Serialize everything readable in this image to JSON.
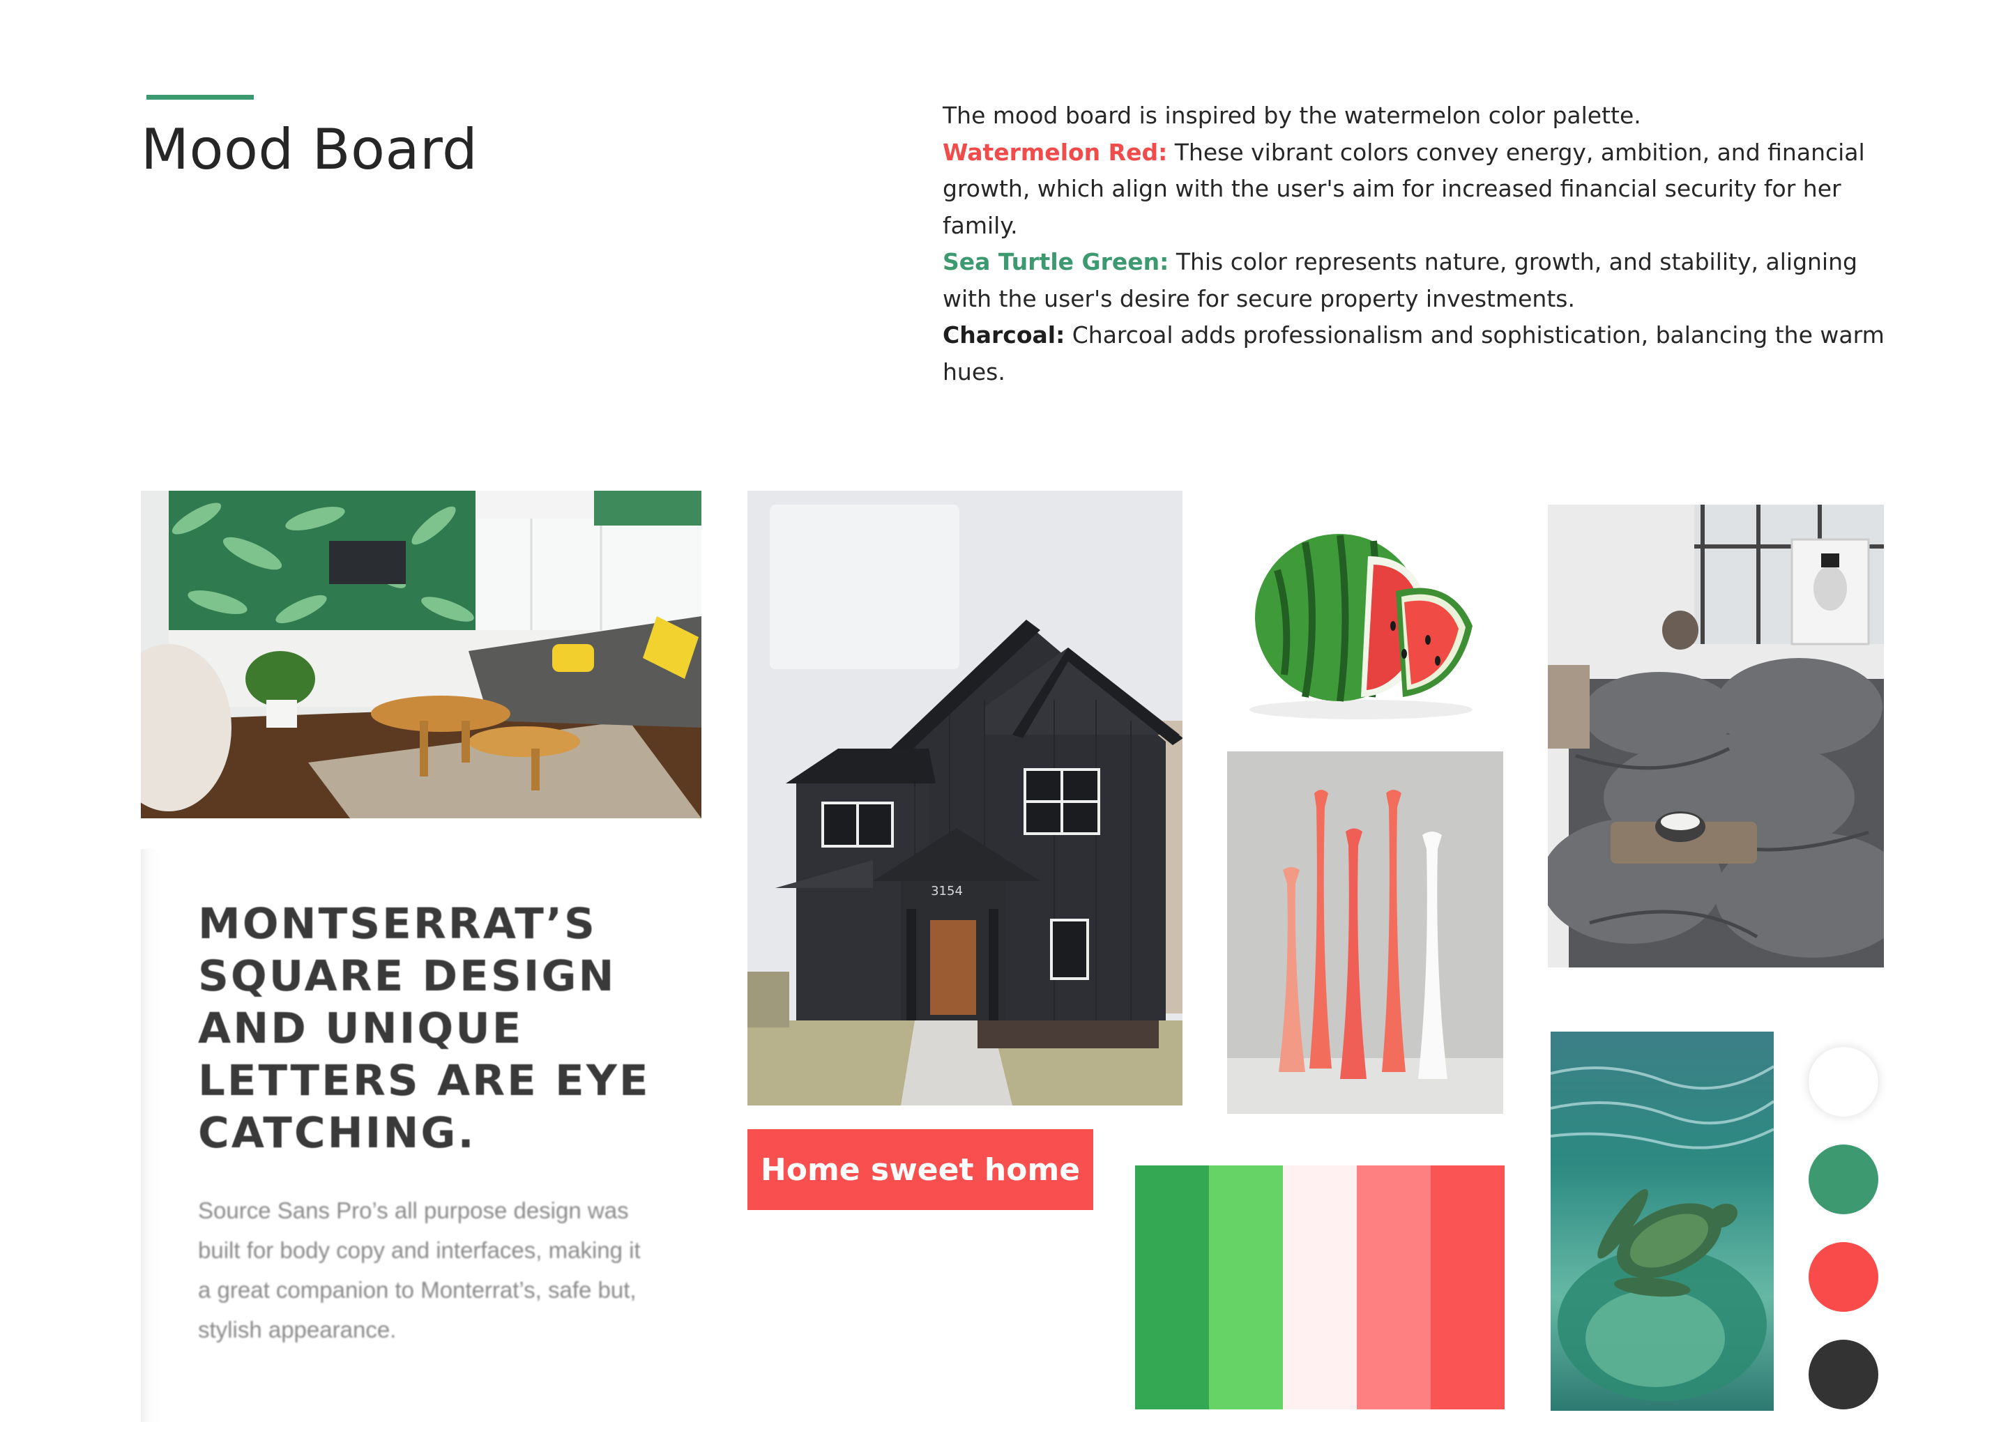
{
  "header": {
    "title": "Mood Board"
  },
  "intro": {
    "lead": "The mood board is inspired by the watermelon color palette.",
    "items": [
      {
        "label": "Watermelon Red:",
        "text": " These vibrant colors convey energy, ambition, and financial growth, which align with the user's aim for increased financial security for her family."
      },
      {
        "label": "Sea Turtle Green:",
        "text": " This color represents nature, growth, and stability, aligning with the user's desire for secure property investments."
      },
      {
        "label": "Charcoal:",
        "text": " Charcoal adds professionalism and sophistication, balancing the warm hues."
      }
    ]
  },
  "typography_card": {
    "heading": "MONTSERRAT’S SQUARE DESIGN AND UNIQUE LETTERS ARE EYE CATCHING.",
    "body": "Source Sans Pro’s all purpose design was built for body copy and interfaces, making it a great companion to Monterrat’s, safe but, stylish appearance."
  },
  "house": {
    "number": "3154"
  },
  "button": {
    "label": "Home sweet home"
  },
  "palette_strip": [
    "#35a853",
    "#66d366",
    "#fff0f1",
    "#ff8080",
    "#fa5454"
  ],
  "swatches": {
    "white": "#ffffff",
    "green": "#3d9970",
    "red": "#fa4b4b",
    "charcoal": "#333333"
  },
  "images": {
    "living_room": "living-room-photo",
    "house": "black-house-photo",
    "watermelon": "watermelon-photo",
    "candles": "candle-holders-photo",
    "bedroom": "grey-bedroom-photo",
    "turtle": "sea-turtle-photo"
  }
}
